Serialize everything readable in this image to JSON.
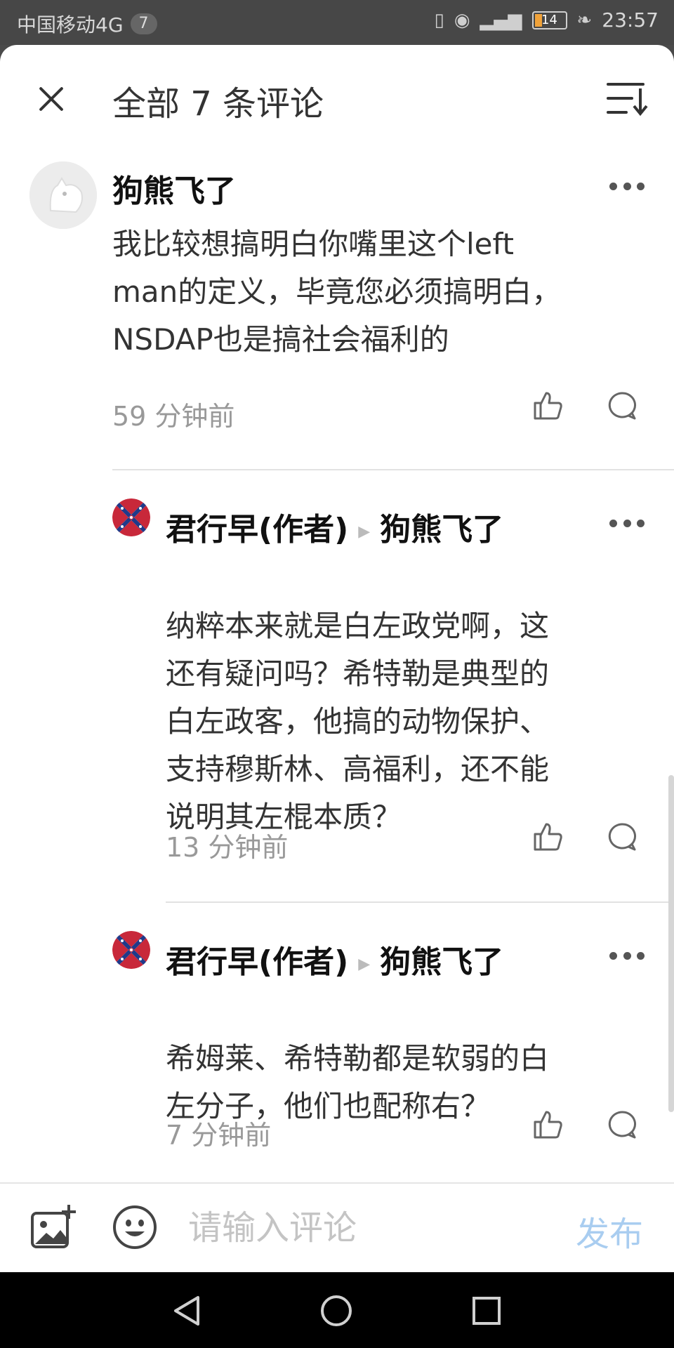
{
  "status_bar": {
    "carrier": "中国移动4G",
    "notification_count": "7",
    "battery": "14",
    "time": "23:57"
  },
  "header": {
    "title": "全部 7 条评论"
  },
  "comments": [
    {
      "author": "狗熊飞了",
      "text_lines": [
        "我比较想搞明白你嘴里这个left",
        "man的定义，毕竟您必须搞明白，",
        "NSDAP也是搞社会福利的"
      ],
      "time": "59 分钟前"
    },
    {
      "author": "君行早(作者)",
      "reply_to": "狗熊飞了",
      "text_lines": [
        "纳粹本来就是白左政党啊，这",
        "还有疑问吗？希特勒是典型的",
        "白左政客，他搞的动物保护、",
        "支持穆斯林、高福利，还不能",
        "说明其左棍本质？"
      ],
      "time": "13 分钟前"
    },
    {
      "author": "君行早(作者)",
      "reply_to": "狗熊飞了",
      "text_lines": [
        "希姆莱、希特勒都是软弱的白",
        "左分子，他们也配称右？"
      ],
      "time": "7 分钟前"
    }
  ],
  "input_bar": {
    "placeholder": "请输入评论",
    "publish_label": "发布",
    "publish_color": "#a9cdf0"
  },
  "icons": {
    "close": "close-icon",
    "sort": "sort-icon",
    "more": "more-icon",
    "like": "thumbs-up-icon",
    "reply": "comment-bubble-icon",
    "add_image": "add-image-icon",
    "emoji": "emoji-icon",
    "nav_back": "triangle-back-icon",
    "nav_home": "circle-home-icon",
    "nav_recents": "square-recents-icon"
  }
}
